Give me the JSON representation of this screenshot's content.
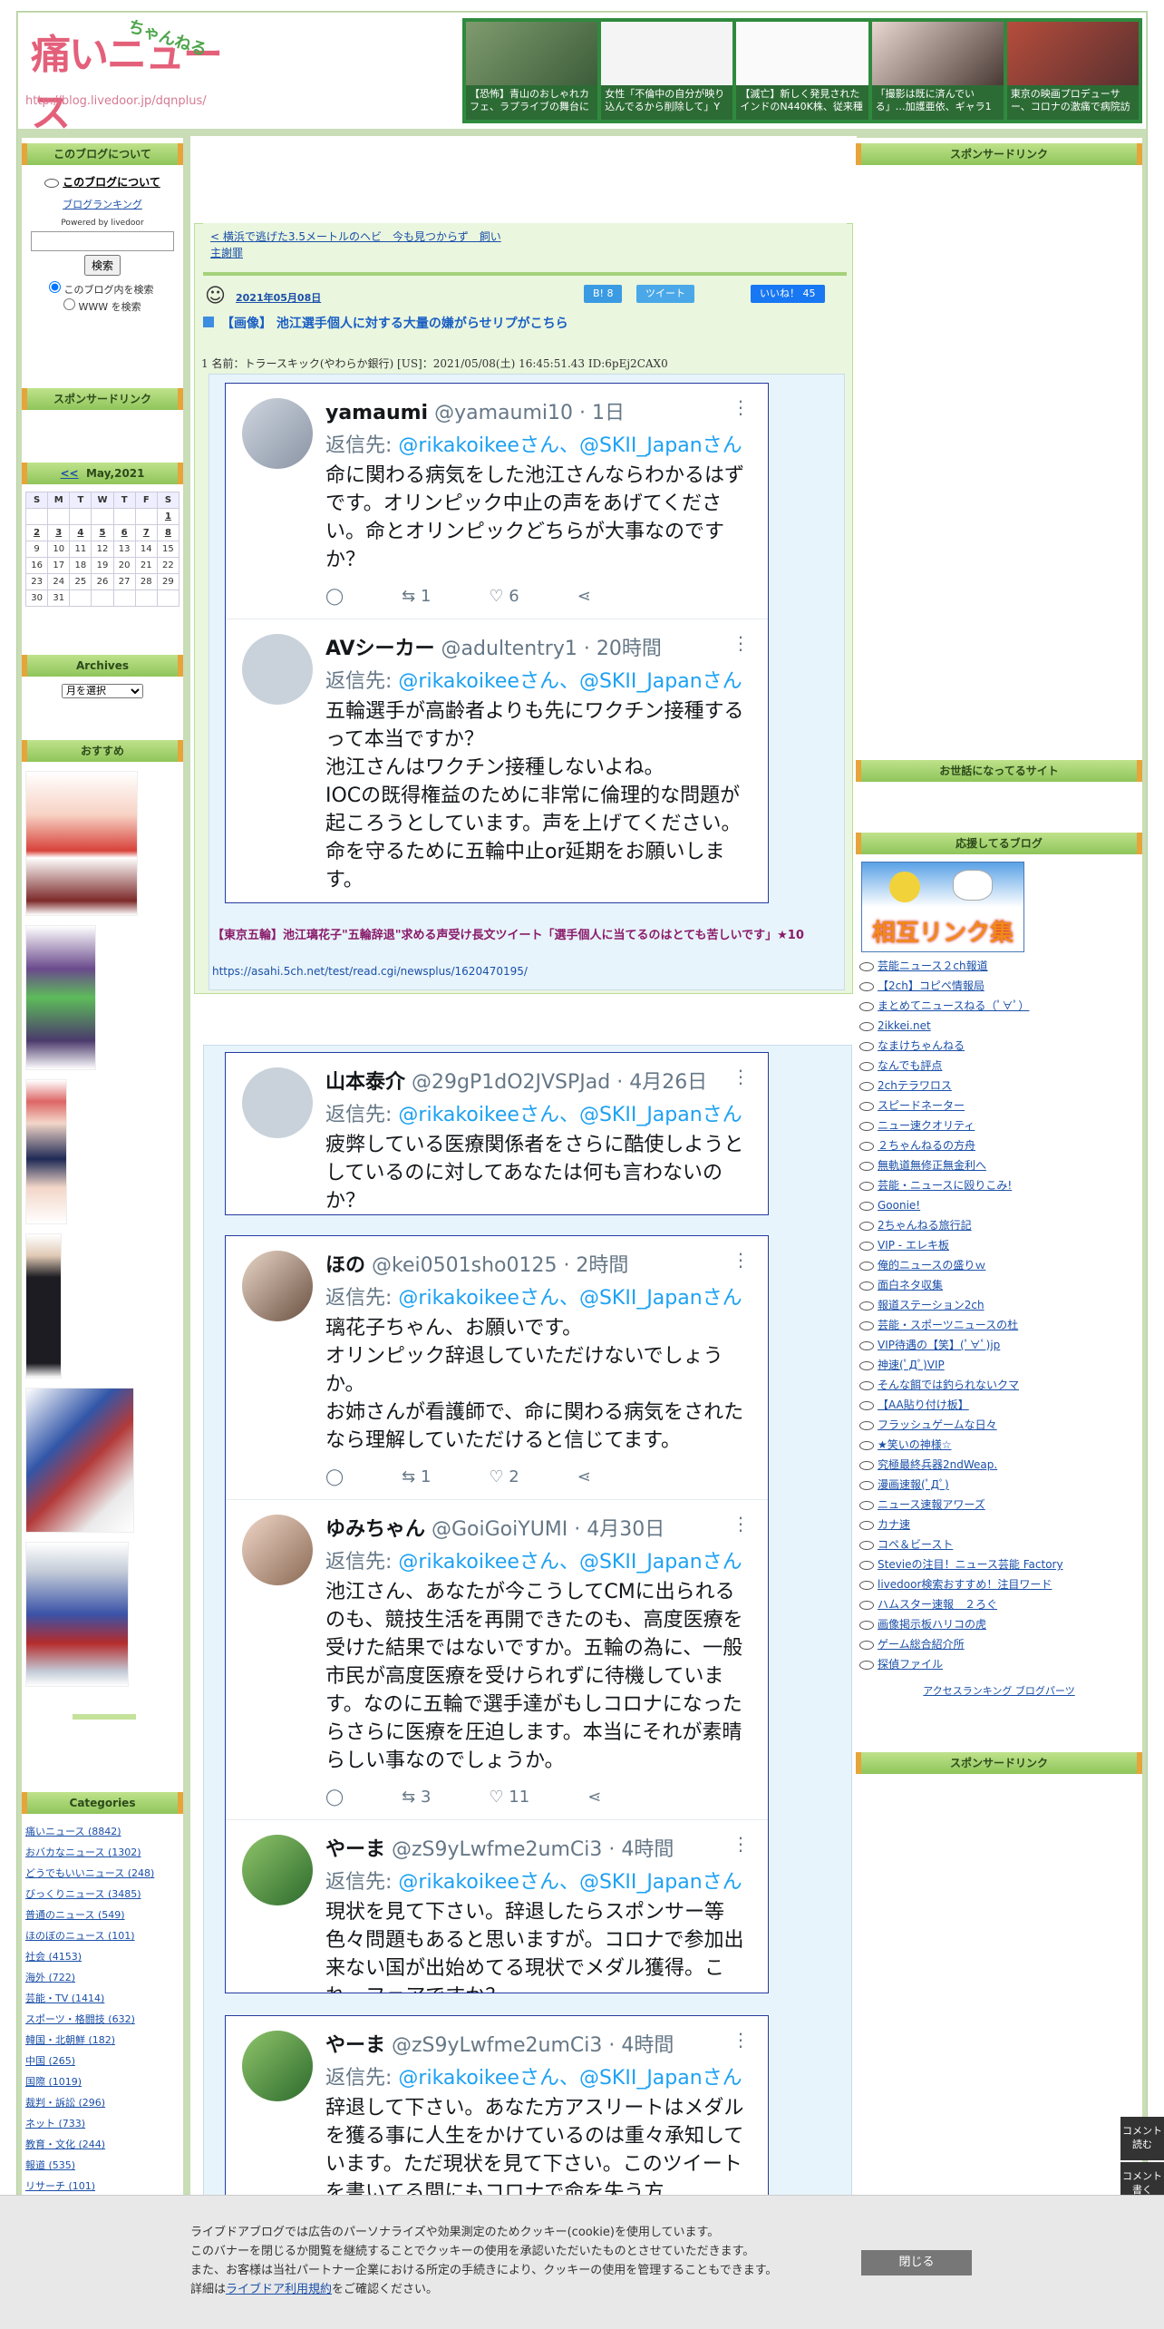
{
  "header": {
    "logo_main": "痛いニュース",
    "logo_sub": "ちゃんねる",
    "logo_url": "http://blog.livedoor.jp/dqnplus/",
    "thumbs": [
      "【恐怖】青山のおしゃれカフェ、ラプライブの舞台に",
      "女性「不倫中の自分が映り込んでるから削除して」Y",
      "【滅亡】新しく発見されたインドのN440K株、従来種",
      "「撮影は既に済んでいる」…加護亜依、ギャラ1",
      "東京の映画プロデューサー、コロナの激痛で病院訪"
    ]
  },
  "left": {
    "about_h": "このブログについて",
    "about_link": "このブログについて",
    "ranking_link": "ブログランキング",
    "powered": "Powered by livedoor",
    "search_btn": "検索",
    "radio1": "このブログ内を検索",
    "radio2": "WWW を検索",
    "sponsor_h": "スポンサードリンク",
    "cal_nav": "<<",
    "cal_title": "May,2021",
    "cal_head": [
      "S",
      "M",
      "T",
      "W",
      "T",
      "F",
      "S"
    ],
    "cal_rows": [
      [
        "",
        "",
        "",
        "",
        "",
        "",
        "1"
      ],
      [
        "2",
        "3",
        "4",
        "5",
        "6",
        "7",
        "8"
      ],
      [
        "9",
        "10",
        "11",
        "12",
        "13",
        "14",
        "15"
      ],
      [
        "16",
        "17",
        "18",
        "19",
        "20",
        "21",
        "22"
      ],
      [
        "23",
        "24",
        "25",
        "26",
        "27",
        "28",
        "29"
      ],
      [
        "30",
        "31",
        "",
        "",
        "",
        "",
        ""
      ]
    ],
    "archives_h": "Archives",
    "archives_select": "月を選択",
    "osusume_h": "おすすめ",
    "categories_h": "Categories",
    "categories": [
      "痛いニュース (8842)",
      "おバカなニュース (1302)",
      "どうでもいいニュース (248)",
      "びっくりニュース (3485)",
      "普通のニュース (549)",
      "ほのぼのニュース (101)",
      "社会 (4153)",
      "海外 (722)",
      "芸能・TV (1414)",
      "スポーツ・格闘技 (632)",
      "韓国・北朝鮮 (182)",
      "中国 (265)",
      "国際 (1019)",
      "裁判・訴訟 (296)",
      "ネット (733)",
      "教育・文化 (244)",
      "報道 (535)",
      "リサーチ (101)"
    ]
  },
  "main": {
    "prev_link": "< 横浜で逃げた3.5メートルのヘビ　今も見つからず　飼い主謝罪",
    "date": "2021年05月08日",
    "hatena": "B! 8",
    "tweet_btn": "ツイート",
    "like_btn": "いいね！ 45",
    "title": "【画像】 池江選手個人に対する大量の嫌がらせリプがこちら",
    "res_line": "1 名前：トラースキック(やわらか銀行) [US]：2021/05/08(土) 16:45:51.43 ID:6pEj2CAX0",
    "link_title": "【東京五輪】池江璃花子\"五輪辞退\"求める声受け長文ツイート「選手個人に当てるのはとても苦しいです」★10",
    "link_url": "https://asahi.5ch.net/test/read.cgi/newsplus/1620470195/",
    "tweets1": [
      {
        "name": "yamaumi",
        "handle": "@yamaumi10 · 1日",
        "reply": "@rikakoikeeさん、@SKII_Japanさん",
        "body": "命に関わる病気をした池江さんならわかるはずです。オリンピック中止の声をあげてください。命とオリンピックどちらが大事なのですか？",
        "rt": "1",
        "like": "6"
      },
      {
        "name": "AVシーカー",
        "handle": "@adultentry1 · 20時間",
        "reply": "@rikakoikeeさん、@SKII_Japanさん",
        "body": "五輪選手が高齢者よりも先にワクチン接種するって本当ですか？\n池江さんはワクチン接種しないよね。\nIOCの既得権益のために非常に倫理的な問題が起ころうとしています。声を上げてください。\n命を守るために五輪中止or延期をお願いします。",
        "rt": "",
        "like": ""
      }
    ],
    "tweet_single": {
      "name": "山本泰介",
      "handle": "@29gP1dO2JVSPJad · 4月26日",
      "reply": "@rikakoikeeさん、@SKII_Japanさん",
      "body": "疲弊している医療関係者をさらに酷使しようとしているのに対してあなたは何も言わないのか？"
    },
    "tweets2": [
      {
        "name": "ほの",
        "handle": "@kei0501sho0125 · 2時間",
        "reply": "@rikakoikeeさん、@SKII_Japanさん",
        "body": "璃花子ちゃん、お願いです。\nオリンピック辞退していただけないでしょうか。\nお姉さんが看護師で、命に関わる病気をされたなら理解していただけると信じてます。",
        "rt": "1",
        "like": "2"
      },
      {
        "name": "ゆみちゃん",
        "handle": "@GoiGoiYUMI · 4月30日",
        "reply": "@rikakoikeeさん、@SKII_Japanさん",
        "body": "池江さん、あなたが今こうしてCMに出られるのも、競技生活を再開できたのも、高度医療を受けた結果ではないですか。五輪の為に、一般市民が高度医療を受けられずに待機しています。なのに五輪で選手達がもしコロナになったらさらに医療を圧迫します。本当にそれが素晴らしい事なのでしょうか。",
        "rt": "3",
        "like": "11"
      },
      {
        "name": "やーま",
        "handle": "@zS9yLwfme2umCi3 · 4時間",
        "reply": "@rikakoikeeさん、@SKII_Japanさん",
        "body": "現状を見て下さい。辞退したらスポンサー等色々問題もあると思いますが。コロナで参加出来ない国が出始めてる現状でメダル獲得。これ、フェアですか？",
        "rt": "",
        "like": ""
      }
    ],
    "tweet_last": {
      "name": "やーま",
      "handle": "@zS9yLwfme2umCi3 · 4時間",
      "reply": "@rikakoikeeさん、@SKII_Japanさん",
      "body": "辞退して下さい。あなた方アスリートはメダルを獲る事に人生をかけているのは重々承知しています。ただ現状を見て下さい。このツイートを書いてる間にもコロナで命を失う方"
    }
  },
  "right": {
    "sponsor_h": "スポンサードリンク",
    "sewa_h": "お世話になってるサイト",
    "ouen_h": "応援してるブログ",
    "banner": "相互リンク集",
    "links": [
      "芸能ニュース２ch報道",
      "【2ch】コピペ情報局",
      "まとめてニュースねる（ﾟ∀ﾟ）",
      "2ikkei.net",
      "なまけちゃんねる",
      "なんでも評点",
      "2chテラワロス",
      "スピードネーター",
      "ニュー速クオリティ",
      "２ちゃんねるの方舟",
      "無軌道無修正無金利へ",
      "芸能・ニュースに殴りこみ!",
      "Goonie!",
      "2ちゃんねる旅行記",
      "VIP - エレキ板",
      "俺的ニュースの盛りｗ",
      "面白ネタ収集",
      "報道ステーション2ch",
      "芸能・スポーツニュースの杜",
      "VIP待遇の【笑】(ﾟ∀ﾟ)jp",
      "神速(ﾟДﾟ)VIP",
      "そんな餌では釣られないクマ",
      "【AA貼り付け板】",
      "フラッシュゲームな日々",
      "★笑いの神様☆",
      "究極最終兵器2ndWeap.",
      "漫画速報(ﾟДﾟ)",
      "ニュース速報アワーズ",
      "カナ速",
      "コペ＆ビースト",
      "Stevieの注目！ニュース芸能 Factory",
      "livedoor検索おすすめ！注目ワード",
      "ハムスター速報　２ろぐ",
      "画像掲示板ハリコの虎",
      "ゲーム総合紹介所",
      "探偵ファイル"
    ],
    "access": "アクセスランキング ブログパーツ",
    "sponsor2_h": "スポンサードリンク"
  },
  "side": {
    "comment1": "コメント読む",
    "comment2": "コメント書く"
  },
  "cookie": {
    "lines": [
      "ライブドアブログでは広告のパーソナライズや効果測定のためクッキー(cookie)を使用しています。",
      "このバナーを閉じるか閲覧を継続することでクッキーの使用を承認いただいたものとさせていただきます。",
      "また、お客様は当社パートナー企業における所定の手続きにより、クッキーの使用を管理することもできます。"
    ],
    "detail_pre": "詳細は",
    "detail_link": "ライブドア利用規約",
    "detail_post": "をご確認ください。",
    "close": "閉じる"
  }
}
